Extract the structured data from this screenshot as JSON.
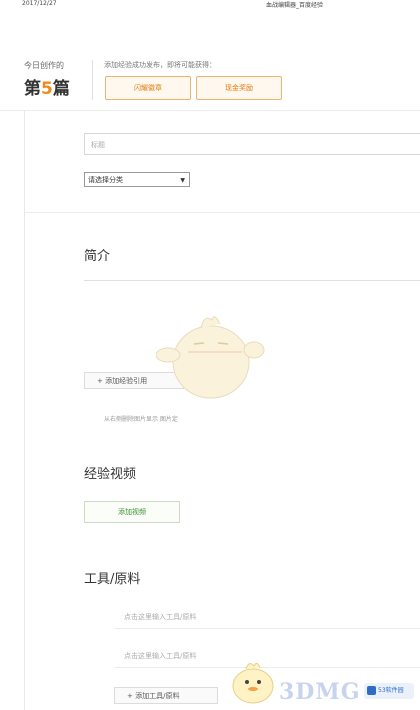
{
  "header": {
    "date": "2017/12/27",
    "title": "血战编辑器_百度经验"
  },
  "today": {
    "label": "今日创作的",
    "count_prefix": "第",
    "count_num": "5",
    "count_suffix": "篇"
  },
  "tip": {
    "text": "添加经验成功发布，即将可能获得：",
    "btn_1": "闪耀徽章",
    "btn_2": "现金奖励"
  },
  "form": {
    "title_placeholder": "标题",
    "category_selected": "请选择分类",
    "intro_heading": "简介",
    "add_step_label": "+ 添加经验引用",
    "image_hint": "从右侧删除图片显示 图片定",
    "video_heading": "经验视频",
    "add_video_label": "添加视频",
    "tools_heading": "工具/原料",
    "tool_row_1": "点击这里输入工具/原料",
    "tool_row_2": "点击这里输入工具/原料",
    "add_tool_label": "+ 添加工具/原料"
  },
  "watermark": {
    "brand": "3DMG",
    "logo_text": "53软件园"
  },
  "icons": {
    "select_arrow": "chevron-down-icon",
    "mascot": "mascot-icon"
  },
  "colors": {
    "accent_orange": "#f08a1c",
    "video_green": "#3a8d2f"
  }
}
